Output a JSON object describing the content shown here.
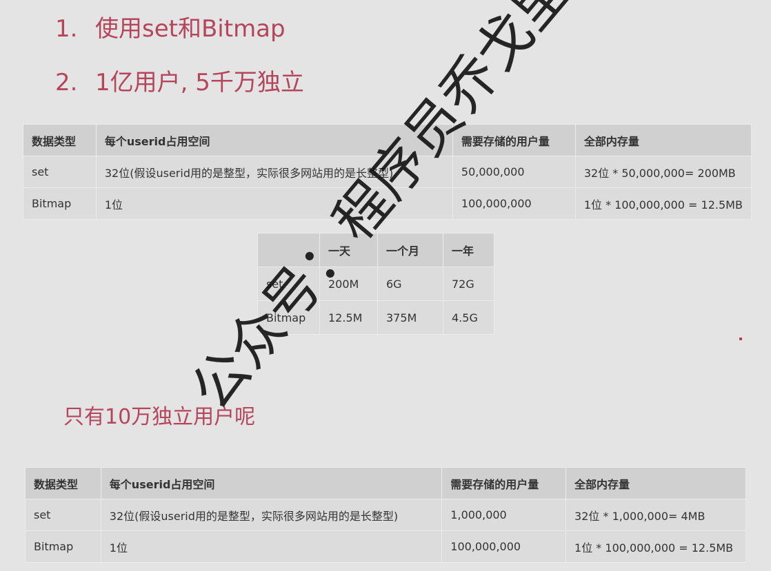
{
  "headings": [
    {
      "num": "1.",
      "text": "使用set和Bitmap"
    },
    {
      "num": "2.",
      "text": "1亿用户, 5千万独立"
    }
  ],
  "subheading": "只有10万独立用户呢",
  "main_table": {
    "headers": [
      "数据类型",
      "每个userid占用空间",
      "需要存储的用户量",
      "全部内存量"
    ],
    "rows": [
      [
        "set",
        "32位(假设userid用的是整型，实际很多网站用的是长整型)",
        "50,000,000",
        "32位 * 50,000,000= 200MB"
      ],
      [
        "Bitmap",
        "1位",
        "100,000,000",
        "1位 * 100,000,000 = 12.5MB"
      ]
    ]
  },
  "compare_table": {
    "headers": [
      "",
      "一天",
      "一个月",
      "一年"
    ],
    "rows": [
      [
        "set",
        "200M",
        "6G",
        "72G"
      ],
      [
        "Bitmap",
        "12.5M",
        "375M",
        "4.5G"
      ]
    ]
  },
  "bottom_table": {
    "headers": [
      "数据类型",
      "每个userid占用空间",
      "需要存储的用户量",
      "全部内存量"
    ],
    "rows": [
      [
        "set",
        "32位(假设userid用的是整型，实际很多网站用的是长整型)",
        "1,000,000",
        "32位 * 1,000,000= 4MB"
      ],
      [
        "Bitmap",
        "1位",
        "100,000,000",
        "1位 * 100,000,000 = 12.5MB"
      ]
    ]
  },
  "watermark": "公众号：程序员乔戈里"
}
